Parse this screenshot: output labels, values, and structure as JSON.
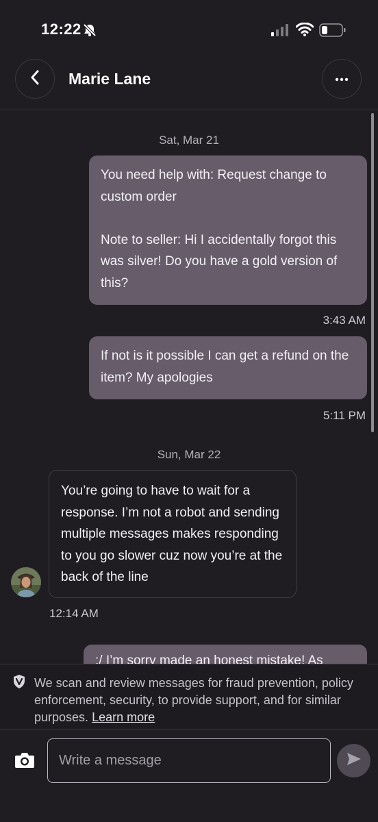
{
  "status_bar": {
    "time": "12:22"
  },
  "header": {
    "contact_name": "Marie Lane"
  },
  "conversation": {
    "date_1": "Sat, Mar 21",
    "message_1": {
      "text": "You need help with: Request change to custom order\n\nNote to seller: Hi I accidentally forgot this was silver! Do you have a gold version of this?",
      "time": "3:43 AM"
    },
    "message_2": {
      "text": "If not is it possible I can get a refund on the item? My apologies",
      "time": "5:11 PM"
    },
    "date_2": "Sun, Mar 22",
    "message_3": {
      "text": "You’re going to have to wait for a response. I’m not a robot and sending multiple messages makes responding to you go slower cuz now you’re at the back of the line",
      "time": "12:14 AM"
    },
    "message_4_partial": {
      "text": ":/ I’m sorry made an honest mistake! As"
    }
  },
  "notice": {
    "text": "We scan and review messages for fraud prevention, policy enforcement, security, to provide support, and for similar purposes.",
    "link": "Learn more"
  },
  "composer": {
    "placeholder": "Write a message"
  },
  "colors": {
    "background": "#1f1d22",
    "outgoing_bubble": "#665c6a",
    "send_button": "#4f4a54"
  }
}
